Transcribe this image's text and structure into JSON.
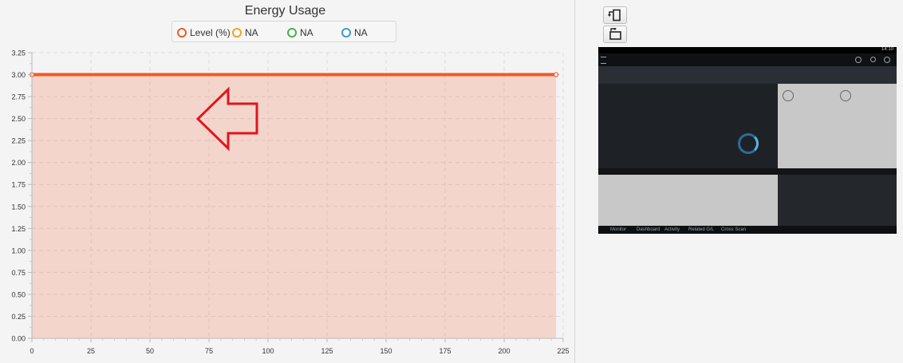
{
  "chart_data": {
    "type": "area",
    "title": "Energy Usage",
    "xlabel": "",
    "ylabel": "",
    "xlim": [
      0,
      225
    ],
    "ylim": [
      0,
      3.25
    ],
    "x_ticks": [
      "0",
      "25",
      "50",
      "75",
      "100",
      "125",
      "150",
      "175",
      "200",
      "225"
    ],
    "y_ticks": [
      "0.00",
      "0.25",
      "0.50",
      "0.75",
      "1.00",
      "1.25",
      "1.50",
      "1.75",
      "2.00",
      "2.25",
      "2.50",
      "2.75",
      "3.00",
      "3.25"
    ],
    "grid": true,
    "legend_position": "top-center",
    "series": [
      {
        "name": "Level (%)",
        "color": "#f05a28",
        "x": [
          0,
          222
        ],
        "y": [
          3.0,
          3.0
        ]
      },
      {
        "name": "NA",
        "color": "#f0a020",
        "x": [],
        "y": []
      },
      {
        "name": "NA",
        "color": "#4aae4a",
        "x": [],
        "y": []
      },
      {
        "name": "NA",
        "color": "#3a9ccc",
        "x": [],
        "y": []
      }
    ],
    "annotation": {
      "type": "arrow",
      "direction": "left",
      "color": "#e3141c"
    }
  },
  "controls": {
    "rotate_left_icon": "rotate-left-icon",
    "rotate_right_icon": "rotate-right-icon"
  },
  "preview": {
    "tabs": [
      "Monitor",
      "Dashboard",
      "Activity",
      "Related G/L",
      "Cross Scan"
    ],
    "clock": "14:10"
  }
}
